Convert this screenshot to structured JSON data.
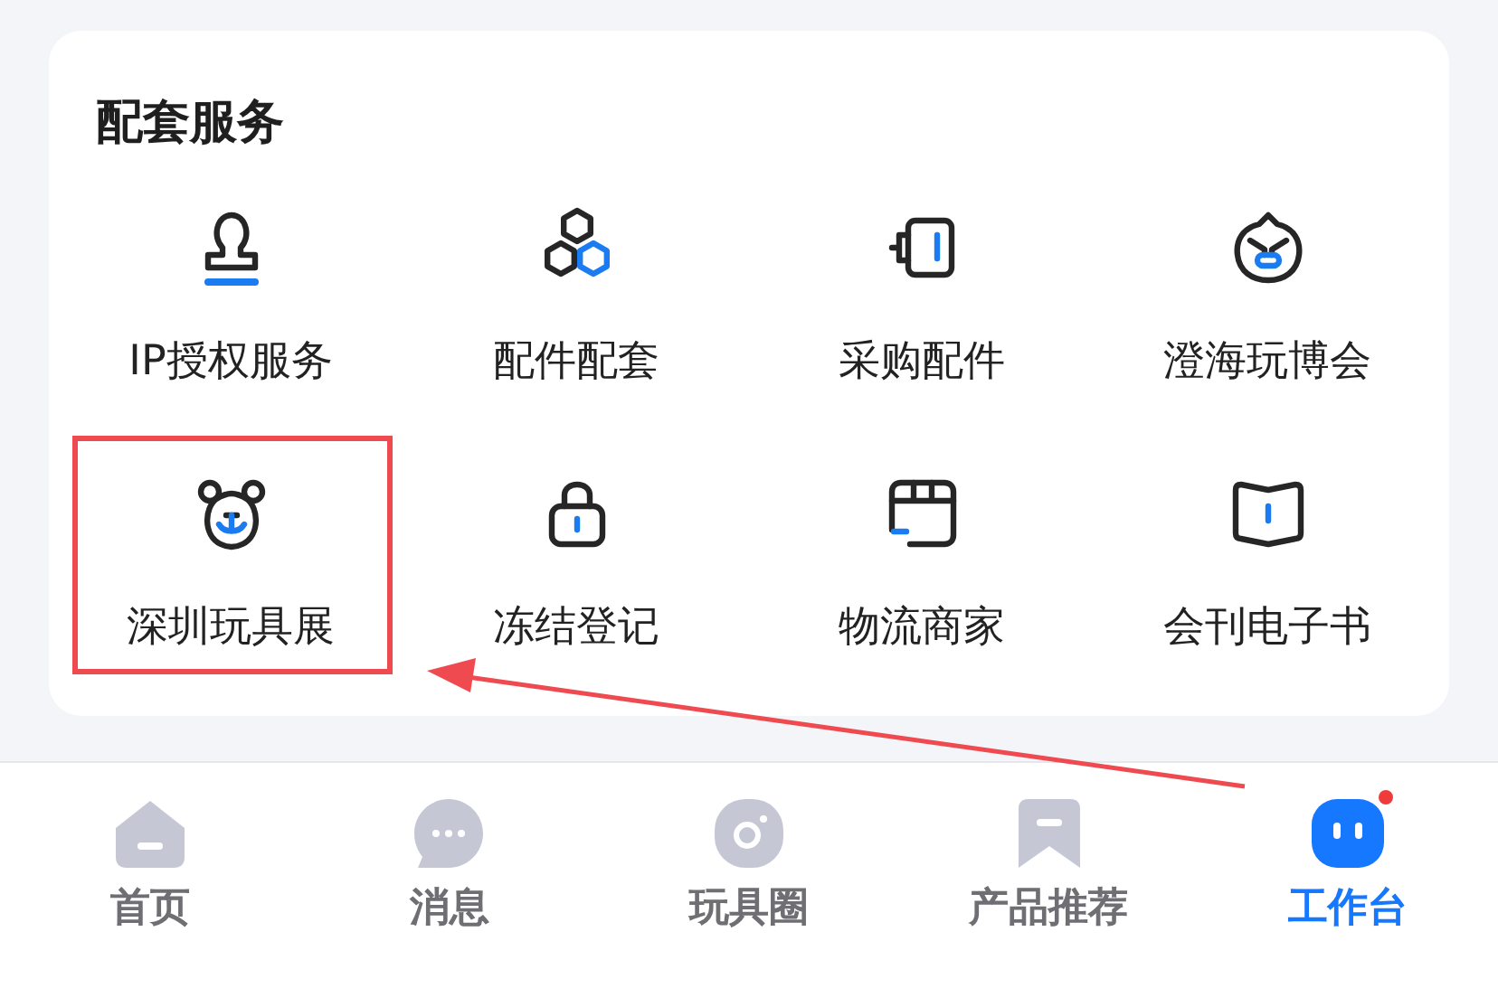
{
  "section": {
    "title": "配套服务",
    "items": [
      {
        "label": "IP授权服务",
        "highlighted": false
      },
      {
        "label": "配件配套",
        "highlighted": false
      },
      {
        "label": "采购配件",
        "highlighted": false
      },
      {
        "label": "澄海玩博会",
        "highlighted": false
      },
      {
        "label": "深圳玩具展",
        "highlighted": true
      },
      {
        "label": "冻结登记",
        "highlighted": false
      },
      {
        "label": "物流商家",
        "highlighted": false
      },
      {
        "label": "会刊电子书",
        "highlighted": false
      }
    ]
  },
  "tab_bar": [
    {
      "label": "首页",
      "selected": false,
      "dot": false
    },
    {
      "label": "消息",
      "selected": false,
      "dot": false
    },
    {
      "label": "玩具圈",
      "selected": false,
      "dot": false
    },
    {
      "label": "产品推荐",
      "selected": false,
      "dot": false
    },
    {
      "label": "工作台",
      "selected": true,
      "dot": true
    }
  ]
}
